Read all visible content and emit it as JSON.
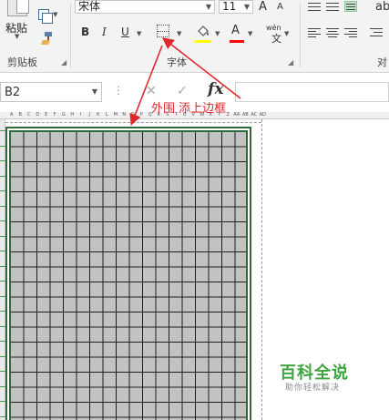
{
  "ribbon": {
    "clipboard": {
      "paste_label": "粘贴",
      "group_label": "剪贴板",
      "icons": [
        "paste-icon",
        "copy-icon",
        "format-painter-icon"
      ]
    },
    "font": {
      "font_name": "宋体",
      "font_size": "11",
      "grow_label": "A",
      "shrink_label": "A",
      "bold_label": "B",
      "italic_label": "I",
      "underline_label": "U",
      "font_color_label": "A",
      "phonetic_top": "wén",
      "phonetic_bottom": "文",
      "group_label": "字体",
      "fill_color": "#ffff00",
      "font_color": "#ff0000"
    },
    "alignment": {
      "group_label": "对",
      "wrap_label": "ab"
    }
  },
  "formula_bar": {
    "name_box": "B2",
    "fx_label": "fx",
    "formula": ""
  },
  "annotation": {
    "text": "外围 添上边框",
    "color": "#e0292d"
  },
  "sheet": {
    "columns": [
      "A",
      "B",
      "C",
      "D",
      "E",
      "F",
      "G",
      "H",
      "I",
      "J",
      "K",
      "L",
      "M",
      "N",
      "O",
      "P",
      "Q",
      "R",
      "S",
      "T",
      "U",
      "V",
      "W",
      "X",
      "Y",
      "Z",
      "AA",
      "AB",
      "AC",
      "AD"
    ],
    "cell_fill": "#c2c2c2",
    "outer_border_color": "#2f6b3a"
  },
  "watermark": {
    "title": "百科全说",
    "subtitle": "助你轻松解决"
  }
}
